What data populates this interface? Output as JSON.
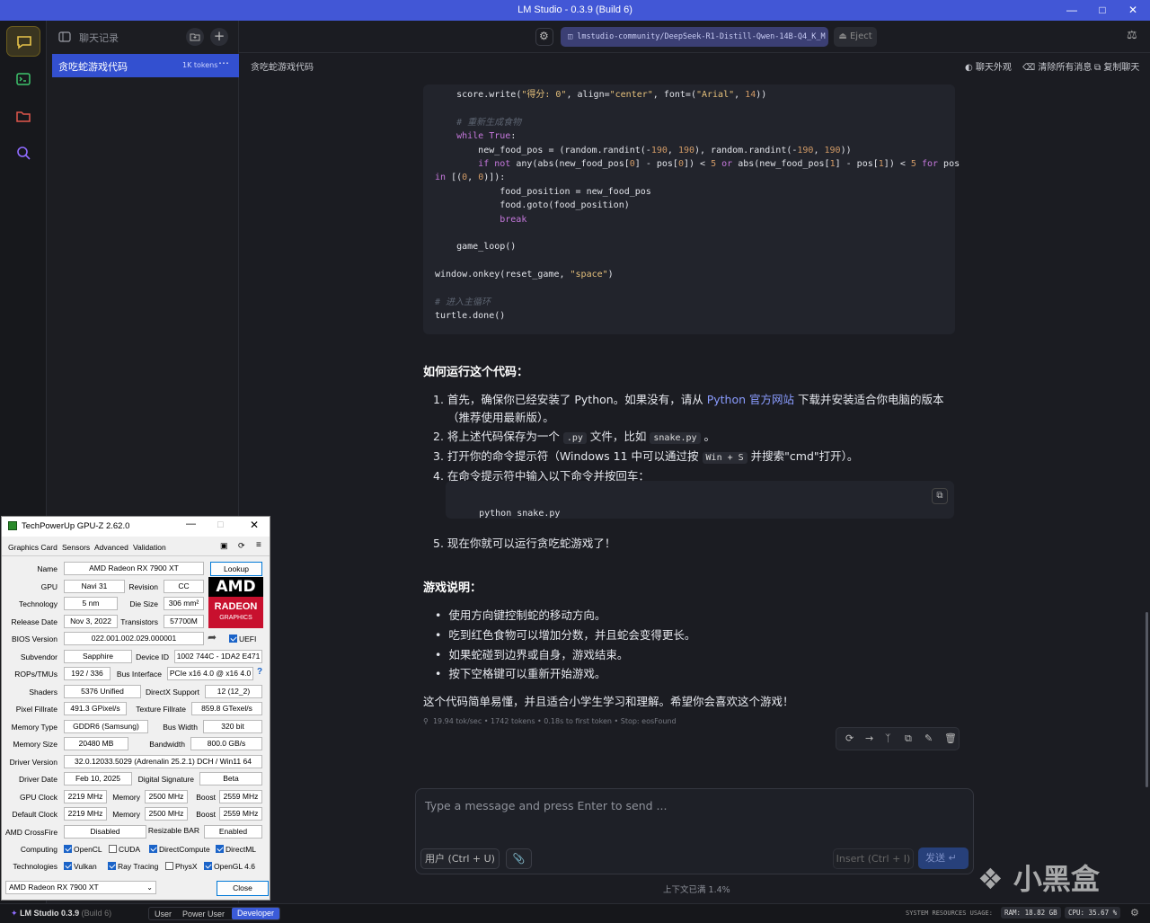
{
  "window": {
    "title": "LM Studio - 0.3.9 (Build 6)"
  },
  "sidebar": {
    "header_label": "聊天记录",
    "chat": {
      "title": "贪吃蛇游戏代码",
      "tokens": "1K tokens"
    }
  },
  "topbar": {
    "model": "lmstudio-community/DeepSeek-R1-Distill-Qwen-14B-Q4_K_M",
    "eject": "Eject"
  },
  "subbar": {
    "chat_title": "贪吃蛇游戏代码",
    "appearance": "聊天外观",
    "clear": "清除所有消息",
    "copy": "复制聊天"
  },
  "code": {
    "lines": [
      {
        "i": "    ",
        "seg": [
          [
            "",
            "score.write("
          ],
          [
            "str",
            "\"得分: 0\""
          ],
          [
            "",
            ", align="
          ],
          [
            "str",
            "\"center\""
          ],
          [
            "",
            ", font=("
          ],
          [
            "str",
            "\"Arial\""
          ],
          [
            "",
            ", "
          ],
          [
            "num",
            "14"
          ],
          [
            "",
            "))"
          ]
        ]
      },
      {
        "i": "",
        "seg": []
      },
      {
        "i": "    ",
        "seg": [
          [
            "cm",
            "# 重新生成食物"
          ]
        ]
      },
      {
        "i": "    ",
        "seg": [
          [
            "kw",
            "while"
          ],
          [
            "",
            " "
          ],
          [
            "kw",
            "True"
          ],
          [
            "",
            ":"
          ]
        ]
      },
      {
        "i": "        ",
        "seg": [
          [
            "",
            "new_food_pos = (random.randint(-"
          ],
          [
            "num",
            "190"
          ],
          [
            "",
            ", "
          ],
          [
            "num",
            "190"
          ],
          [
            "",
            "), random.randint(-"
          ],
          [
            "num",
            "190"
          ],
          [
            "",
            ", "
          ],
          [
            "num",
            "190"
          ],
          [
            "",
            "))"
          ]
        ]
      },
      {
        "i": "        ",
        "seg": [
          [
            "kw",
            "if not"
          ],
          [
            "",
            " any(abs(new_food_pos["
          ],
          [
            "num",
            "0"
          ],
          [
            "",
            "] - pos["
          ],
          [
            "num",
            "0"
          ],
          [
            "",
            "]) < "
          ],
          [
            "num",
            "5"
          ],
          [
            "kw",
            " or"
          ],
          [
            "",
            " abs(new_food_pos["
          ],
          [
            "num",
            "1"
          ],
          [
            "",
            "] - pos["
          ],
          [
            "num",
            "1"
          ],
          [
            "",
            "]) < "
          ],
          [
            "num",
            "5"
          ],
          [
            "kw",
            " for"
          ],
          [
            "",
            " pos"
          ]
        ]
      },
      {
        "i": "",
        "seg": [
          [
            "kw",
            "in"
          ],
          [
            "",
            " [("
          ],
          [
            "num",
            "0"
          ],
          [
            "",
            ", "
          ],
          [
            "num",
            "0"
          ],
          [
            "",
            ")]):"
          ]
        ]
      },
      {
        "i": "            ",
        "seg": [
          [
            "",
            "food_position = new_food_pos"
          ]
        ]
      },
      {
        "i": "            ",
        "seg": [
          [
            "",
            "food.goto(food_position)"
          ]
        ]
      },
      {
        "i": "            ",
        "seg": [
          [
            "kw",
            "break"
          ]
        ]
      },
      {
        "i": "",
        "seg": []
      },
      {
        "i": "    ",
        "seg": [
          [
            "",
            "game_loop()"
          ]
        ]
      },
      {
        "i": "",
        "seg": []
      },
      {
        "i": "",
        "seg": [
          [
            "",
            "window.onkey(reset_game, "
          ],
          [
            "str",
            "\"space\""
          ],
          [
            "",
            ")"
          ]
        ]
      },
      {
        "i": "",
        "seg": []
      },
      {
        "i": "",
        "seg": [
          [
            "cm",
            "# 进入主循环"
          ]
        ]
      },
      {
        "i": "",
        "seg": [
          [
            "",
            "turtle.done()"
          ]
        ]
      }
    ]
  },
  "how": {
    "heading": "如何运行这个代码：",
    "s1a": "1. 首先，确保你已经安装了 Python。如果没有，请从 ",
    "s1link": "Python 官方网站",
    "s1b": " 下载并安装适合你电脑的版本",
    "s1c": "（推荐使用最新版）。",
    "s2a": "2. 将上述代码保存为一个 ",
    "s2code": ".py",
    "s2b": " 文件，比如 ",
    "s2file": "snake.py",
    "s2c": " 。",
    "s3a": "3. 打开你的命令提示符（Windows 11 中可以通过按 ",
    "s3key": "Win + S",
    "s3b": " 并搜索\"cmd\"打开）。",
    "s4": "4. 在命令提示符中输入以下命令并按回车：",
    "cmd": "python snake.py",
    "s5": "5. 现在你就可以运行贪吃蛇游戏了！"
  },
  "guide": {
    "heading": "游戏说明：",
    "items": [
      "使用方向键控制蛇的移动方向。",
      "吃到红色食物可以增加分数，并且蛇会变得更长。",
      "如果蛇碰到边界或自身，游戏结束。",
      "按下空格键可以重新开始游戏。"
    ],
    "closing": "这个代码简单易懂，并且适合小学生学习和理解。希望你会喜欢这个游戏！"
  },
  "stats": "19.94 tok/sec • 1742 tokens • 0.18s to first token • Stop: eosFound",
  "input": {
    "placeholder": "Type a message and press Enter to send ...",
    "role": "用户 (Ctrl + U)",
    "insert": "Insert (Ctrl + I)",
    "send": "发送",
    "context": "上下文已满 1.4%"
  },
  "watermark": "小黑盒",
  "status": {
    "app": "LM Studio 0.3.9",
    "build": "(Build 6)",
    "modes": [
      "User",
      "Power User",
      "Developer"
    ],
    "res_label": "SYSTEM RESOURCES USAGE:",
    "ram": "RAM: 18.82 GB",
    "cpu": "CPU: 35.67 %"
  },
  "gpuz": {
    "title": "TechPowerUp GPU-Z 2.62.0",
    "tabs": [
      "Graphics Card",
      "Sensors",
      "Advanced",
      "Validation"
    ],
    "lookup": "Lookup",
    "name": "AMD Radeon RX 7900 XT",
    "gpu": "Navi 31",
    "revision": "CC",
    "technology": "5 nm",
    "die_size": "306 mm²",
    "release": "Nov 3, 2022",
    "transistors": "57700M",
    "bios": "022.001.002.029.000001",
    "uefi": "UEFI",
    "subvendor": "Sapphire",
    "device_id": "1002 744C - 1DA2 E471",
    "rops": "192 / 336",
    "bus": "PCIe x16 4.0 @ x16 4.0",
    "shaders": "5376 Unified",
    "directx": "12 (12_2)",
    "pixel": "491.3 GPixel/s",
    "texture": "859.8 GTexel/s",
    "memtype": "GDDR6 (Samsung)",
    "buswidth": "320 bit",
    "memsize": "20480 MB",
    "bandwidth": "800.0 GB/s",
    "driver": "32.0.12033.5029 (Adrenalin 25.2.1) DCH / Win11 64",
    "driverdate": "Feb 10, 2025",
    "digsig": "Beta",
    "gpuclock": "2219 MHz",
    "mem1": "2500 MHz",
    "boost1": "2559 MHz",
    "defclock": "2219 MHz",
    "mem2": "2500 MHz",
    "boost2": "2559 MHz",
    "crossfire": "Disabled",
    "rebar": "Enabled",
    "labels": {
      "name": "Name",
      "gpu": "GPU",
      "revision": "Revision",
      "technology": "Technology",
      "die": "Die Size",
      "release": "Release Date",
      "transistors": "Transistors",
      "bios": "BIOS Version",
      "subvendor": "Subvendor",
      "device": "Device ID",
      "rops": "ROPs/TMUs",
      "bus": "Bus Interface",
      "shaders": "Shaders",
      "dx": "DirectX Support",
      "pixel": "Pixel Fillrate",
      "texture": "Texture Fillrate",
      "memtype": "Memory Type",
      "buswidth": "Bus Width",
      "memsize": "Memory Size",
      "bandwidth": "Bandwidth",
      "driver": "Driver Version",
      "driverdate": "Driver Date",
      "digsig": "Digital Signature",
      "gpuclock": "GPU Clock",
      "memory": "Memory",
      "boost": "Boost",
      "defclock": "Default Clock",
      "crossfire": "AMD CrossFire",
      "rebar": "Resizable BAR",
      "computing": "Computing",
      "technologies": "Technologies"
    },
    "computing": [
      "OpenCL",
      "CUDA",
      "DirectCompute",
      "DirectML"
    ],
    "technologies": [
      "Vulkan",
      "Ray Tracing",
      "PhysX",
      "OpenGL 4.6"
    ],
    "select": "AMD Radeon RX 7900 XT",
    "close": "Close",
    "logo_top": "AMD",
    "logo_mid": "RADEON",
    "logo_bot": "GRAPHICS"
  }
}
